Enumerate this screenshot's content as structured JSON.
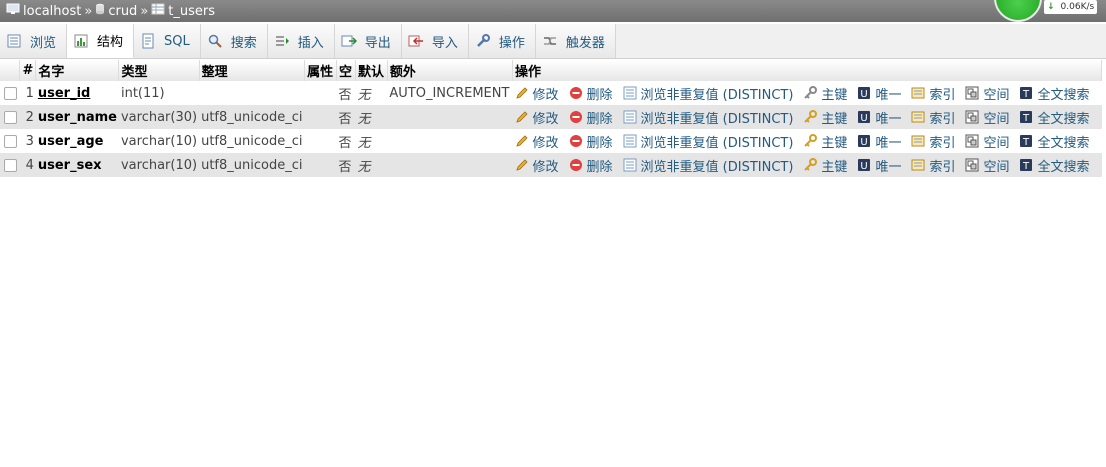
{
  "breadcrumb": {
    "server": "localhost",
    "database": "crud",
    "table": "t_users",
    "separator": "»"
  },
  "network": {
    "speed": "0.06K/s",
    "arrow": "↓"
  },
  "tabs": [
    {
      "label": "浏览",
      "icon": "browse-icon"
    },
    {
      "label": "结构",
      "icon": "structure-icon"
    },
    {
      "label": "SQL",
      "icon": "sql-icon"
    },
    {
      "label": "搜索",
      "icon": "search-icon"
    },
    {
      "label": "插入",
      "icon": "insert-icon"
    },
    {
      "label": "导出",
      "icon": "export-icon"
    },
    {
      "label": "导入",
      "icon": "import-icon"
    },
    {
      "label": "操作",
      "icon": "wrench-icon"
    },
    {
      "label": "触发器",
      "icon": "trigger-icon"
    }
  ],
  "table": {
    "headers": {
      "num": "#",
      "name": "名字",
      "type": "类型",
      "collation": "整理",
      "attributes": "属性",
      "null": "空",
      "default": "默认",
      "extra": "额外",
      "actions": "操作"
    },
    "rows": [
      {
        "num": "1",
        "name": "user_id",
        "type": "int(11)",
        "collation": "",
        "attributes": "",
        "null": "否",
        "default": "无",
        "extra": "AUTO_INCREMENT"
      },
      {
        "num": "2",
        "name": "user_name",
        "type": "varchar(30)",
        "collation": "utf8_unicode_ci",
        "attributes": "",
        "null": "否",
        "default": "无",
        "extra": ""
      },
      {
        "num": "3",
        "name": "user_age",
        "type": "varchar(10)",
        "collation": "utf8_unicode_ci",
        "attributes": "",
        "null": "否",
        "default": "无",
        "extra": ""
      },
      {
        "num": "4",
        "name": "user_sex",
        "type": "varchar(10)",
        "collation": "utf8_unicode_ci",
        "attributes": "",
        "null": "否",
        "default": "无",
        "extra": ""
      }
    ],
    "actions": {
      "edit": "修改",
      "drop": "删除",
      "distinct": "浏览非重复值 (DISTINCT)",
      "primary": "主键",
      "unique": "唯一",
      "index": "索引",
      "spatial": "空间",
      "fulltext": "全文搜索"
    }
  },
  "colors": {
    "link": "#235a81",
    "tabbar": "#f0f0f0",
    "rowalt": "#e5e5e5",
    "green": "#1d9a1d"
  }
}
